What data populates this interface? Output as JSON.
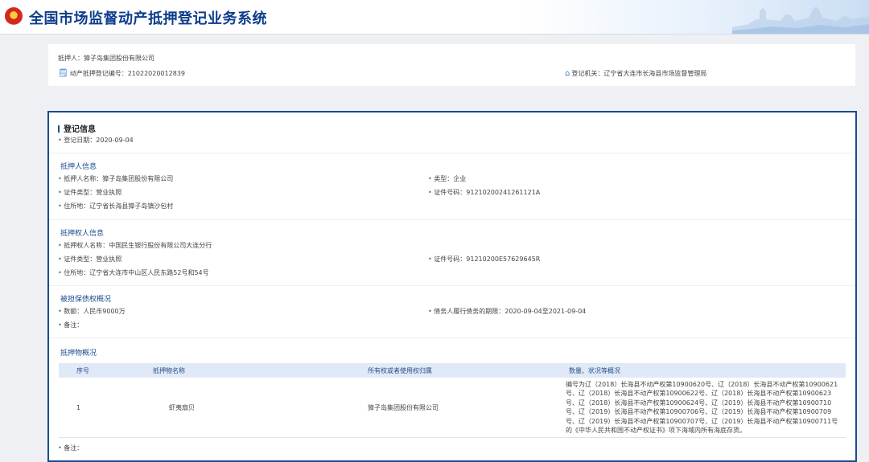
{
  "header": {
    "title": "全国市场监督动产抵押登记业务系统"
  },
  "summary": {
    "mortgagor_label": "抵押人：",
    "mortgagor": "獐子岛集团股份有限公司",
    "reg_no_label": "动产抵押登记编号：",
    "reg_no": "21022020012839",
    "authority_label": "登记机关：",
    "authority": "辽宁省大连市长海县市场监督管理局"
  },
  "registration": {
    "title": "登记信息",
    "date_label": "登记日期：",
    "date": "2020-09-04"
  },
  "mortgagor_info": {
    "title": "抵押人信息",
    "name_label": "抵押人名称：",
    "name": "獐子岛集团股份有限公司",
    "type_label": "类型：",
    "type": "企业",
    "cert_type_label": "证件类型：",
    "cert_type": "营业执照",
    "cert_no_label": "证件号码：",
    "cert_no": "91210200241261121A",
    "address_label": "住所地：",
    "address": "辽宁省长海县獐子岛镇沙包村"
  },
  "mortgagee_info": {
    "title": "抵押权人信息",
    "name_label": "抵押权人名称：",
    "name": "中国民生银行股份有限公司大连分行",
    "cert_type_label": "证件类型：",
    "cert_type": "营业执照",
    "cert_no_label": "证件号码：",
    "cert_no": "91210200E57629645R",
    "address_label": "住所地：",
    "address": "辽宁省大连市中山区人民东路52号和54号"
  },
  "secured_debt": {
    "title": "被担保债权概况",
    "amount_label": "数额：",
    "amount": "人民币9000万",
    "term_label": "债务人履行债务的期限：",
    "term": "2020-09-04至2021-09-04",
    "remark_label": "备注："
  },
  "collateral": {
    "title": "抵押物概况",
    "columns": [
      "序号",
      "抵押物名称",
      "所有权或者使用权归属",
      "数量、状况等概况"
    ],
    "rows": [
      {
        "no": "1",
        "name": "虾夷扇贝",
        "owner": "獐子岛集团股份有限公司",
        "desc": "编号为辽（2018）长海县不动产权第10900620号、辽（2018）长海县不动产权第10900621号、辽（2018）长海县不动产权第10900622号、辽（2018）长海县不动产权第10900623号、辽（2018）长海县不动产权第10900624号、辽（2019）长海县不动产权第10900710号、辽（2019）长海县不动产权第10900706号、辽（2019）长海县不动产权第10900709号、辽（2019）长海县不动产权第10900707号、辽（2019）长海县不动产权第10900711号的《中华人民共和国不动产权证书》项下海域内所有海底存货。"
      }
    ],
    "remark_label": "备注："
  },
  "colors": {
    "brand": "#0d3d8c",
    "border": "#1a4c8f",
    "table_header": "#dfe9f7"
  }
}
